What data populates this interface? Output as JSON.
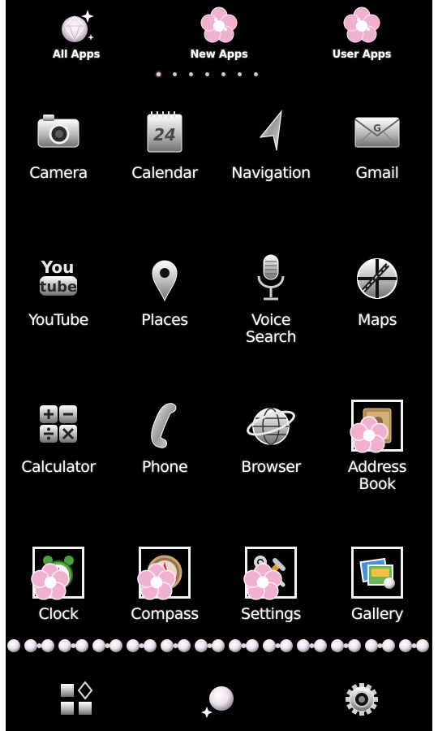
{
  "tabs": [
    {
      "label": "All Apps",
      "icon": "diamond-icon"
    },
    {
      "label": "New Apps",
      "icon": "pink-flower-gem-icon"
    },
    {
      "label": "User Apps",
      "icon": "pink-flower-gem-icon"
    }
  ],
  "page_indicator": {
    "count": 7,
    "active": 0
  },
  "apps": [
    {
      "label": "Camera",
      "icon": "camera-icon"
    },
    {
      "label": "Calendar",
      "icon": "calendar-icon",
      "calendar_day": "24"
    },
    {
      "label": "Navigation",
      "icon": "navigation-arrow-icon"
    },
    {
      "label": "Gmail",
      "icon": "mail-icon"
    },
    {
      "label": "YouTube",
      "icon": "youtube-icon",
      "logo_top": "You",
      "logo_bottom": "tube"
    },
    {
      "label": "Places",
      "icon": "map-pin-icon"
    },
    {
      "label": "Voice\nSearch",
      "icon": "microphone-icon"
    },
    {
      "label": "Maps",
      "icon": "maps-icon"
    },
    {
      "label": "Calculator",
      "icon": "calculator-icon"
    },
    {
      "label": "Phone",
      "icon": "phone-handset-icon"
    },
    {
      "label": "Browser",
      "icon": "globe-icon"
    },
    {
      "label": "Address\nBook",
      "icon": "address-book-icon"
    },
    {
      "label": "Clock",
      "icon": "alarm-clock-icon"
    },
    {
      "label": "Compass",
      "icon": "compass-icon"
    },
    {
      "label": "Settings",
      "icon": "tools-icon"
    },
    {
      "label": "Gallery",
      "icon": "gallery-icon"
    }
  ],
  "dock": [
    {
      "name": "app-drawer",
      "icon": "grid-icon"
    },
    {
      "name": "home",
      "icon": "pearl-icon"
    },
    {
      "name": "settings",
      "icon": "gear-icon"
    }
  ],
  "colors": {
    "background": "#000000",
    "text": "#ffffff",
    "accent_pink": "#f4b8d4",
    "silver": "#c8c8c8"
  }
}
